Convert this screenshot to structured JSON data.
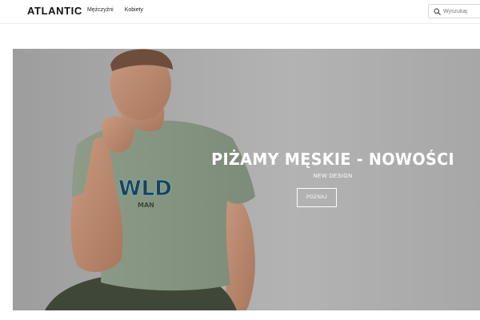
{
  "header": {
    "logo": "ATLANTIC",
    "nav": [
      {
        "label": "Mężczyźni"
      },
      {
        "label": "Kobiety"
      }
    ],
    "search": {
      "placeholder": "Wyszukaj",
      "icon": "search-icon"
    }
  },
  "hero": {
    "title": "PIŻAMY MĘSKIE - NOWOŚCI",
    "subtitle": "NEW DESIGN",
    "cta": "POZNAJ",
    "shirt_print_top": "WLD",
    "shirt_print_bottom": "MAN"
  },
  "colors": {
    "background": "#ffffff",
    "hero_gray": "#a9a9a9",
    "shirt": "#8a9a85",
    "shorts": "#3f4838",
    "text_on_hero": "#ffffff"
  }
}
